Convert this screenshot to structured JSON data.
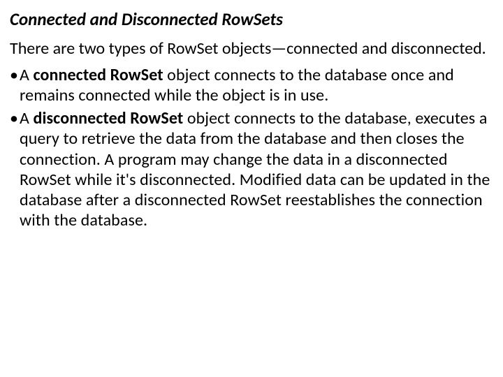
{
  "heading": "Connected and Disconnected RowSets",
  "intro": "There are two types of RowSet objects—connected and disconnected.",
  "items": [
    {
      "prefix": "A ",
      "bold": "connected RowSet",
      "rest": " object connects to the database once and remains connected while the object is in use."
    },
    {
      "prefix": "A ",
      "bold": "disconnected RowSet",
      "rest": " object connects to the database, executes a query to retrieve the data from the database and then closes the connection. A program may change the data in a disconnected RowSet while it's disconnected. Modified data can be updated in the database after a disconnected RowSet reestablishes the connection with the database."
    }
  ]
}
